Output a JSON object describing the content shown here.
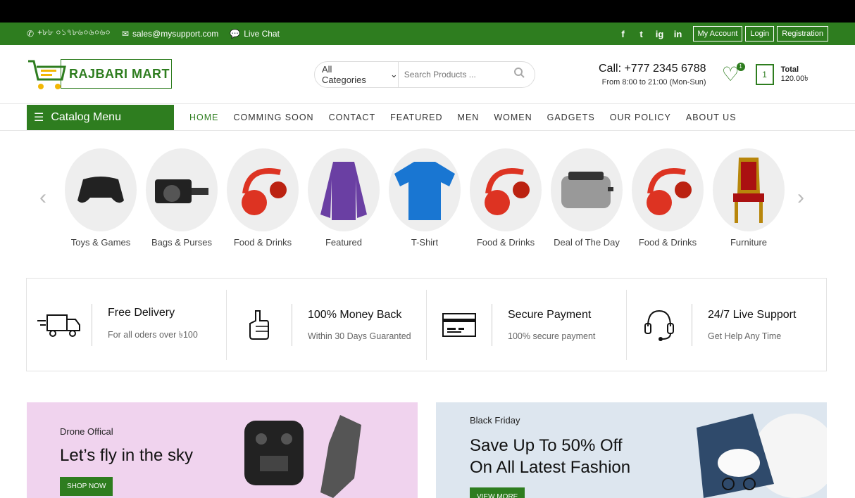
{
  "topbar": {
    "phone": "+৮৮ ০১৭৮৬০৬০৬০",
    "email": "sales@mysupport.com",
    "live_chat": "Live Chat",
    "social": [
      "f",
      "t",
      "ig",
      "in"
    ],
    "my_account": "My Account",
    "login": "Login",
    "registration": "Registration"
  },
  "header": {
    "logo_text": "RAJBARI MART",
    "category_select": "All Categories",
    "search_placeholder": "Search Products ...",
    "call_title": "Call: +777 2345 6788",
    "call_hours": "From 8:00 to 21:00 (Mon-Sun)",
    "wishlist_count": "1",
    "cart_count": "1",
    "total_label": "Total",
    "total_value": "120.00৳"
  },
  "nav": {
    "catalog": "Catalog Menu",
    "items": [
      "HOME",
      "COMMING SOON",
      "CONTACT",
      "FEATURED",
      "MEN",
      "WOMEN",
      "GADGETS",
      "OUR POLICY",
      "ABOUT US"
    ]
  },
  "categories": [
    "Toys & Games",
    "Bags & Purses",
    "Food & Drinks",
    "Featured",
    "T-Shirt",
    "Food & Drinks",
    "Deal of The Day",
    "Food & Drinks",
    "Furniture"
  ],
  "features": [
    {
      "title": "Free Delivery",
      "sub": "For all oders over ৳100",
      "icon": "truck-icon"
    },
    {
      "title": "100% Money Back",
      "sub": "Within 30 Days Guaranted",
      "icon": "thumbs-up-icon"
    },
    {
      "title": "Secure Payment",
      "sub": "100% secure payment",
      "icon": "credit-card-icon"
    },
    {
      "title": "24/7 Live Support",
      "sub": "Get Help Any Time",
      "icon": "headset-icon"
    }
  ],
  "banners": [
    {
      "small": "Drone Offical",
      "big": "Let’s fly in the sky",
      "button": "SHOP NOW"
    },
    {
      "small": "Black Friday",
      "big1": "Save Up To 50% Off",
      "big2": "On All Latest Fashion",
      "button": "VIEW MORE"
    }
  ],
  "colors": {
    "brand": "#2e7d1f"
  }
}
